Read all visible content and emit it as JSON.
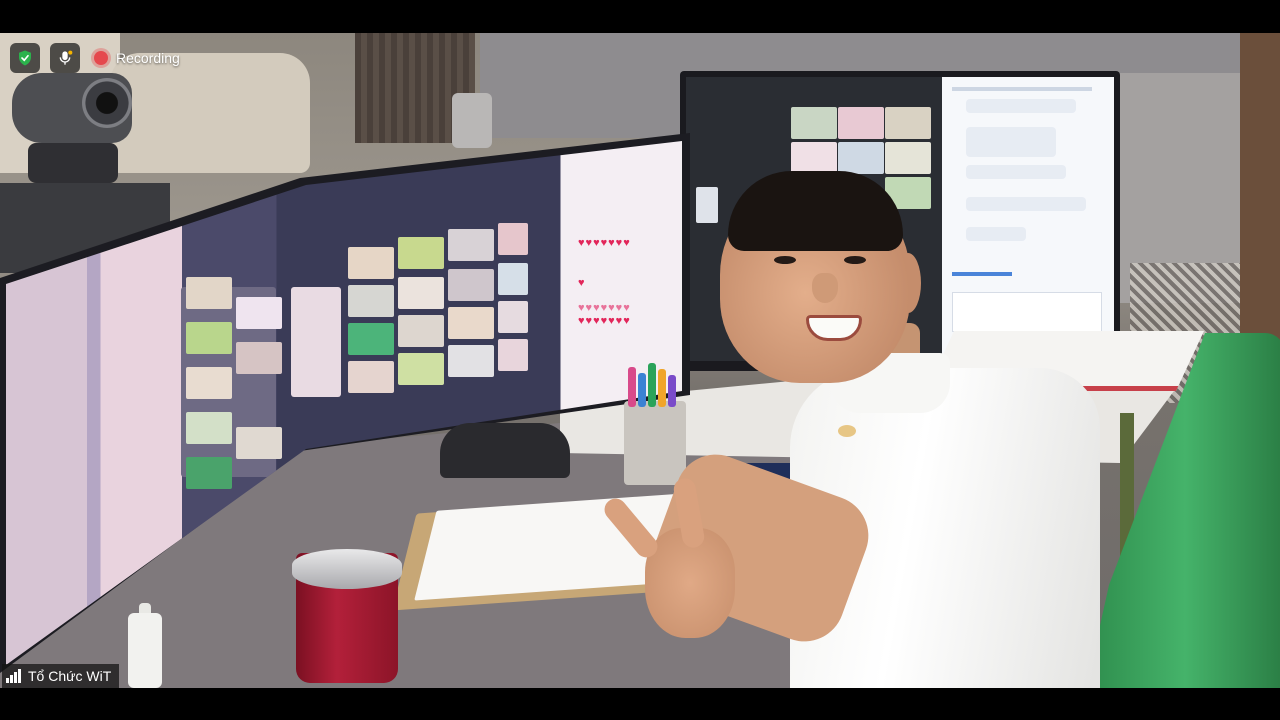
{
  "overlay": {
    "security_icon": "shield-check-icon",
    "mic_icon": "microphone-icon",
    "recording_label": "Recording",
    "recording_color": "#e5484d",
    "security_color": "#2bb24c"
  },
  "participant": {
    "name": "Tổ Chức WiT",
    "signal_icon": "signal-bars-icon"
  },
  "scene": {
    "shirt_color": "#ffffff",
    "chair_color": "#45b36a",
    "cup_color": "#b3203a"
  }
}
